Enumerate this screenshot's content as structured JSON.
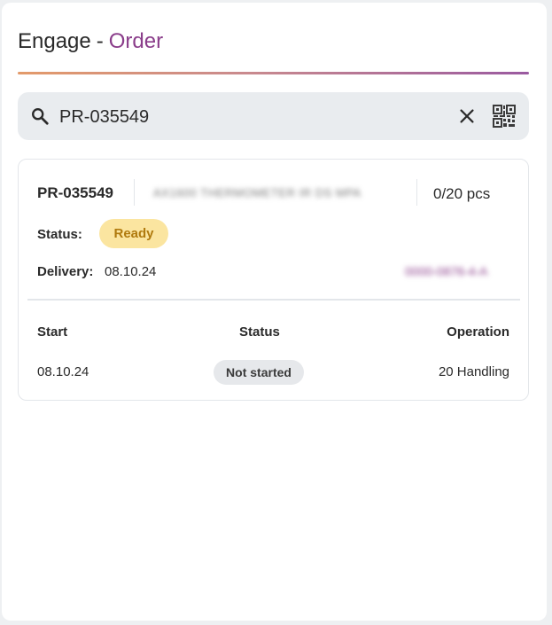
{
  "header": {
    "app": "Engage",
    "separator": "-",
    "section": "Order"
  },
  "search": {
    "value": "PR-035549",
    "icons": [
      "search-icon",
      "clear-icon",
      "qr-code-icon"
    ]
  },
  "order": {
    "number": "PR-035549",
    "description": "AX1600 THERMOMETER IR DS MPA",
    "quantity": "0/20 pcs",
    "status_label": "Status:",
    "status": "Ready",
    "delivery_label": "Delivery:",
    "delivery": "08.10.24",
    "reference": "0000-0876-4-A"
  },
  "operations": {
    "headers": [
      "Start",
      "Status",
      "Operation"
    ],
    "rows": [
      {
        "start": "08.10.24",
        "status": "Not started",
        "operation": "20 Handling"
      }
    ]
  },
  "colors": {
    "accent": "#8a3d8a",
    "ready_badge_bg": "#fbe5a0",
    "ready_badge_text": "#b07a0e",
    "not_started_bg": "#e6e8eb",
    "divider_gradient": [
      "#e39a6a",
      "#9a5aa0"
    ]
  }
}
